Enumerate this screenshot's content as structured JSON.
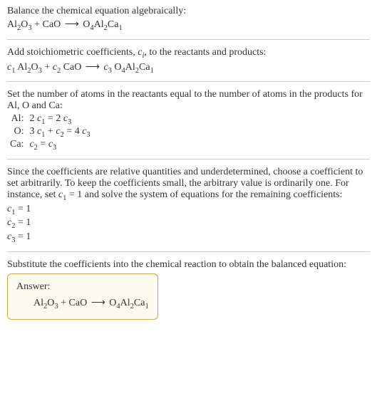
{
  "intro_line": "Balance the chemical equation algebraically:",
  "eq1_lhs1": "Al",
  "eq1_lhs1_sub1": "2",
  "eq1_lhs1_mid": "O",
  "eq1_lhs1_sub2": "3",
  "plus": " + ",
  "eq1_lhs2": "CaO",
  "arrow": " ⟶ ",
  "eq1_rhs": "O",
  "eq1_rhs_sub1": "4",
  "eq1_rhs_mid1": "Al",
  "eq1_rhs_sub2": "2",
  "eq1_rhs_mid2": "Ca",
  "eq1_rhs_sub3": "1",
  "add_line_pre": "Add stoichiometric coefficients, ",
  "add_line_ci_c": "c",
  "add_line_ci_i": "i",
  "add_line_post": ", to the reactants and products:",
  "c1": "c",
  "c1_sub": "1",
  "c2": "c",
  "c2_sub": "2",
  "c3": "c",
  "c3_sub": "3",
  "set_line": "Set the number of atoms in the reactants equal to the number of atoms in the products for Al, O and Ca:",
  "row_al_label": "Al:",
  "row_al_eq_p1": "2 ",
  "row_al_eq_p2": " = 2 ",
  "row_o_label": "O:",
  "row_o_eq_p1": "3 ",
  "row_o_eq_p2": " + ",
  "row_o_eq_p3": " = 4 ",
  "row_ca_label": "Ca:",
  "row_ca_eq_p2": " = ",
  "since_line_p1": "Since the coefficients are relative quantities and underdetermined, choose a coefficient to set arbitrarily. To keep the coefficients small, the arbitrary value is ordinarily one. For instance, set ",
  "since_line_p2": " = 1 and solve the system of equations for the remaining coefficients:",
  "coef1_val": " = 1",
  "coef2_val": " = 1",
  "coef3_val": " = 1",
  "subst_line": "Substitute the coefficients into the chemical reaction to obtain the balanced equation:",
  "answer_label": "Answer:",
  "chart_data": null
}
